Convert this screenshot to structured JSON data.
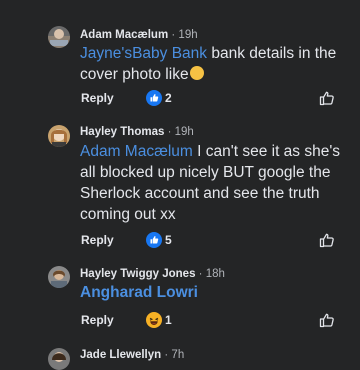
{
  "comments": [
    {
      "author": "Adam Macælum",
      "time": "19h",
      "mention": "Jayne'sBaby Bank",
      "text": " bank details in the cover photo like",
      "reply": "Reply",
      "react_count": "2"
    },
    {
      "author": "Hayley Thomas",
      "time": "19h",
      "mention": "Adam Macælum",
      "text": " I can't see it as she's all blocked  up nicely BUT google the Sherlock account and see the truth coming out  xx",
      "reply": "Reply",
      "react_count": "5"
    },
    {
      "author": "Hayley Twiggy Jones",
      "time": "18h",
      "mention": "Angharad Lowri",
      "text": "",
      "reply": "Reply",
      "react_count": "1"
    },
    {
      "author": "Jade Llewellyn",
      "time": "7h"
    }
  ],
  "separator": " · ",
  "icons": {
    "like": "thumbs-up-outline-icon",
    "reaction_like": "blue-like-reaction-icon",
    "reaction_haha": "haha-reaction-icon"
  },
  "colors": {
    "background": "#242526",
    "text": "#e4e6eb",
    "muted": "#b0b3b8",
    "mention": "#4b8fe0",
    "like_blue": "#1877f2"
  }
}
